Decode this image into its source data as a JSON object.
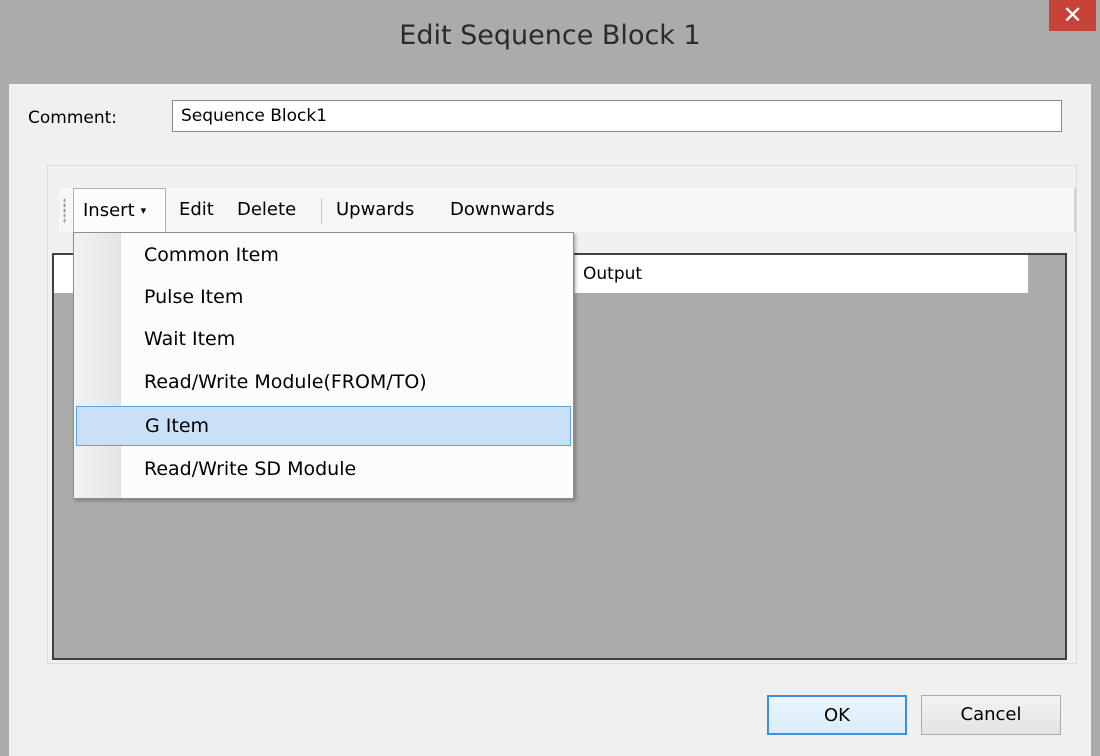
{
  "window": {
    "title": "Edit Sequence Block 1",
    "close_glyph": "✕"
  },
  "comment": {
    "label": "Comment:",
    "value": "Sequence Block1"
  },
  "toolbar": {
    "insert_label": "Insert",
    "insert_arrow": "▾",
    "edit_label": "Edit",
    "delete_label": "Delete",
    "upwards_label": "Upwards",
    "downwards_label": "Downwards"
  },
  "grid": {
    "columns": [
      "",
      "Output"
    ]
  },
  "insert_menu": {
    "items": [
      {
        "label": "Common Item",
        "selected": false
      },
      {
        "label": "Pulse Item",
        "selected": false
      },
      {
        "label": "Wait Item",
        "selected": false
      },
      {
        "label": "Read/Write Module(FROM/TO)",
        "selected": false
      },
      {
        "label": "G Item",
        "selected": true
      },
      {
        "label": "Read/Write SD Module",
        "selected": false
      }
    ]
  },
  "buttons": {
    "ok_label": "OK",
    "cancel_label": "Cancel"
  },
  "colors": {
    "titlebar": "#ababab",
    "close_button": "#c7433a",
    "menu_highlight": "#c8e0f8",
    "default_button_border": "#3c8ee0"
  }
}
